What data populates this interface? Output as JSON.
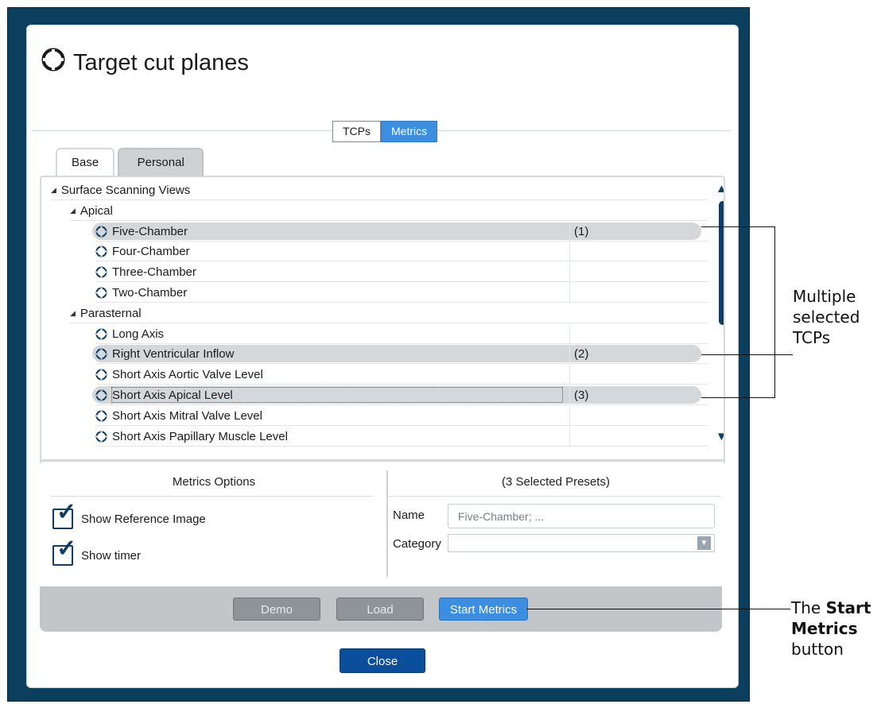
{
  "dialog": {
    "title": "Target cut planes",
    "segment": {
      "tcps": "TCPs",
      "metrics": "Metrics"
    },
    "tabs": {
      "base": "Base",
      "personal": "Personal"
    },
    "tree": [
      {
        "label": "Surface Scanning Views",
        "level": 0,
        "expandable": true
      },
      {
        "label": "Apical",
        "level": 1,
        "expandable": true
      },
      {
        "label": "Five-Chamber",
        "level": 2,
        "selected": true,
        "order": "(1)"
      },
      {
        "label": "Four-Chamber",
        "level": 2
      },
      {
        "label": "Three-Chamber",
        "level": 2
      },
      {
        "label": "Two-Chamber",
        "level": 2
      },
      {
        "label": "Parasternal",
        "level": 1,
        "expandable": true
      },
      {
        "label": "Long Axis",
        "level": 2
      },
      {
        "label": "Right Ventricular Inflow",
        "level": 2,
        "selected": true,
        "order": "(2)"
      },
      {
        "label": "Short Axis Aortic Valve Level",
        "level": 2
      },
      {
        "label": "Short Axis Apical Level",
        "level": 2,
        "selected": true,
        "focused": true,
        "order": "(3)"
      },
      {
        "label": "Short Axis Mitral Valve Level",
        "level": 2
      },
      {
        "label": "Short Axis Papillary Muscle Level",
        "level": 2
      }
    ],
    "metrics_options": {
      "heading": "Metrics Options",
      "show_reference_image": "Show Reference Image",
      "show_timer": "Show timer"
    },
    "presets": {
      "heading": "(3 Selected Presets)",
      "name_label": "Name",
      "name_value": "Five-Chamber; ...",
      "category_label": "Category",
      "category_value": ""
    },
    "buttons": {
      "demo": "Demo",
      "load": "Load",
      "start": "Start Metrics",
      "close": "Close"
    }
  },
  "annotations": {
    "multiple": [
      "Multiple",
      "selected",
      "TCPs"
    ],
    "start_prefix": "The ",
    "start_bold_1": "Start",
    "start_bold_2": "Metrics",
    "start_suffix": "button"
  },
  "colors": {
    "frame": "#0c3e5e",
    "accent": "#3c8fe0",
    "selection": "#d5d8da",
    "close_button": "#0b4f9c"
  }
}
